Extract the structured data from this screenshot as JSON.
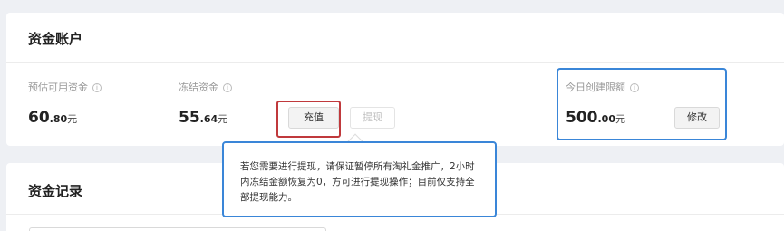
{
  "account": {
    "title": "资金账户",
    "available": {
      "label": "预估可用资金",
      "int": "60",
      "dec": ".80",
      "unit": "元"
    },
    "frozen": {
      "label": "冻结资金",
      "int": "55",
      "dec": ".64",
      "unit": "元"
    },
    "recharge_label": "充值",
    "withdraw_label": "提现",
    "limit": {
      "label": "今日创建限额",
      "int": "500",
      "dec": ".00",
      "unit": "元",
      "modify_label": "修改"
    },
    "info_glyph": "i"
  },
  "tooltip": {
    "text": "若您需要进行提现，请保证暂停所有淘礼金推广，2小时内冻结金额恢复为0，方可进行提现操作；目前仅支持全部提现能力。"
  },
  "records": {
    "title": "资金记录"
  },
  "colors": {
    "highlight_red": "#c0393c",
    "highlight_blue": "#3a86d8",
    "page_bg": "#eef0f4"
  },
  "icons": [
    "info-icon"
  ]
}
